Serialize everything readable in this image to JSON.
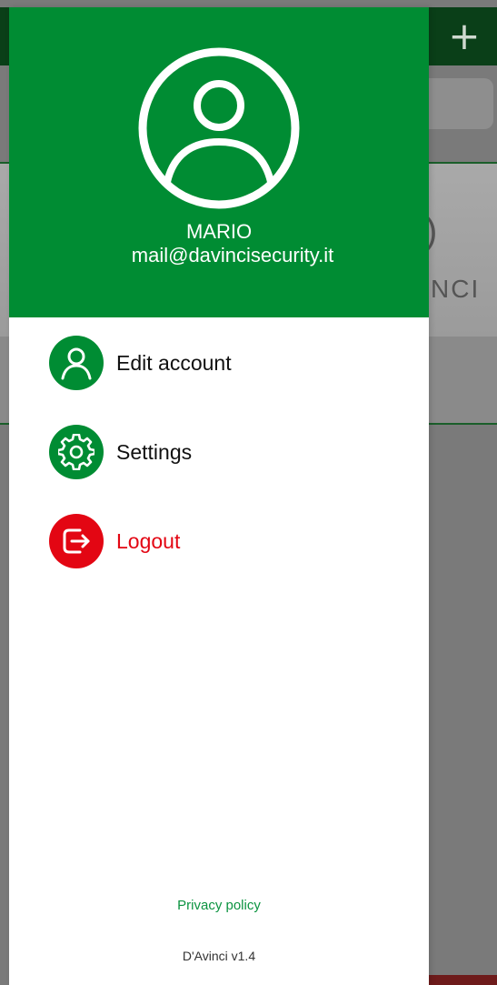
{
  "colors": {
    "primary_green": "#008c33",
    "logout_red": "#e30613",
    "link_green": "#0b9340",
    "dim_overlay": "#7a7a7a"
  },
  "background_app": {
    "add_symbol": "+",
    "banner_partial_text": "NCI",
    "banner_partial_mark": ")"
  },
  "drawer": {
    "header": {
      "avatar_icon": "user-circle-icon",
      "user_name": "MARIO",
      "user_email": "mail@davincisecurity.it"
    },
    "menu": [
      {
        "label": "Edit account",
        "icon": "user-icon"
      },
      {
        "label": "Settings",
        "icon": "gear-icon"
      },
      {
        "label": "Logout",
        "icon": "logout-icon"
      }
    ],
    "privacy_label": "Privacy policy",
    "version": "D'Avinci v1.4"
  }
}
